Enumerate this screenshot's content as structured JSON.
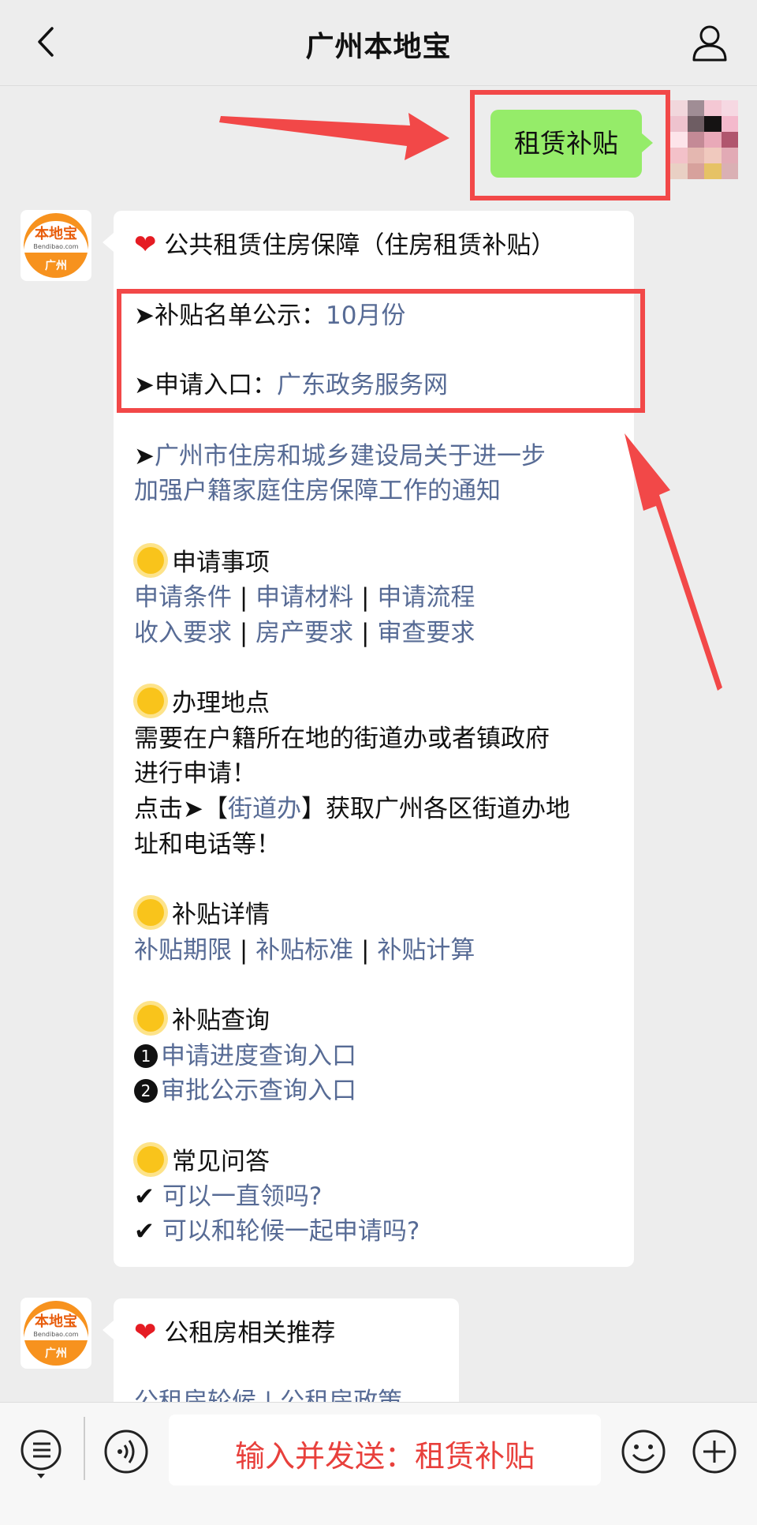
{
  "header": {
    "title": "广州本地宝"
  },
  "outgoing": {
    "text": "租赁补贴"
  },
  "card1": {
    "title": "公共租赁住房保障（住房租赁补贴）",
    "items": [
      {
        "prefix": "➤补贴名单公示：",
        "link": "10月份"
      },
      {
        "prefix": "➤申请入口：",
        "link": "广东政务服务网"
      }
    ],
    "notice_prefix": "➤",
    "notice_line1": "广州市住房和城乡建设局关于进一步",
    "notice_line2": "加强户籍家庭住房保障工作的通知",
    "sec1": {
      "title": "申请事项",
      "row1": [
        "申请条件",
        "申请材料",
        "申请流程"
      ],
      "row2": [
        "收入要求",
        "房产要求",
        "审查要求"
      ]
    },
    "sec2": {
      "title": "办理地点",
      "line1": "需要在户籍所在地的街道办或者镇政府",
      "line2": "进行申请！",
      "line3_prefix": "点击➤【",
      "line3_link": "街道办",
      "line3_suffix": "】获取广州各区街道办地",
      "line4": "址和电话等！"
    },
    "sec3": {
      "title": "补贴详情",
      "row": [
        "补贴期限",
        "补贴标准",
        "补贴计算"
      ]
    },
    "sec4": {
      "title": "补贴查询",
      "n1": "1",
      "item1": "申请进度查询入口",
      "n2": "2",
      "item2": "审批公示查询入口"
    },
    "sec5": {
      "title": "常见问答",
      "check": "✔",
      "q1": "可以一直领吗?",
      "q2": "可以和轮候一起申请吗?"
    },
    "sep": "|"
  },
  "card2": {
    "title": "公租房相关推荐",
    "partial": "公租房轮候 | 公租房政策"
  },
  "avatar": {
    "brand": "本地宝",
    "sub": "Bendibao.com",
    "city": "广州"
  },
  "bottom": {
    "input_text": "输入并发送：租赁补贴"
  },
  "colors": {
    "link": "#576b95",
    "bubble_out": "#95ec69",
    "highlight": "#f24848"
  }
}
